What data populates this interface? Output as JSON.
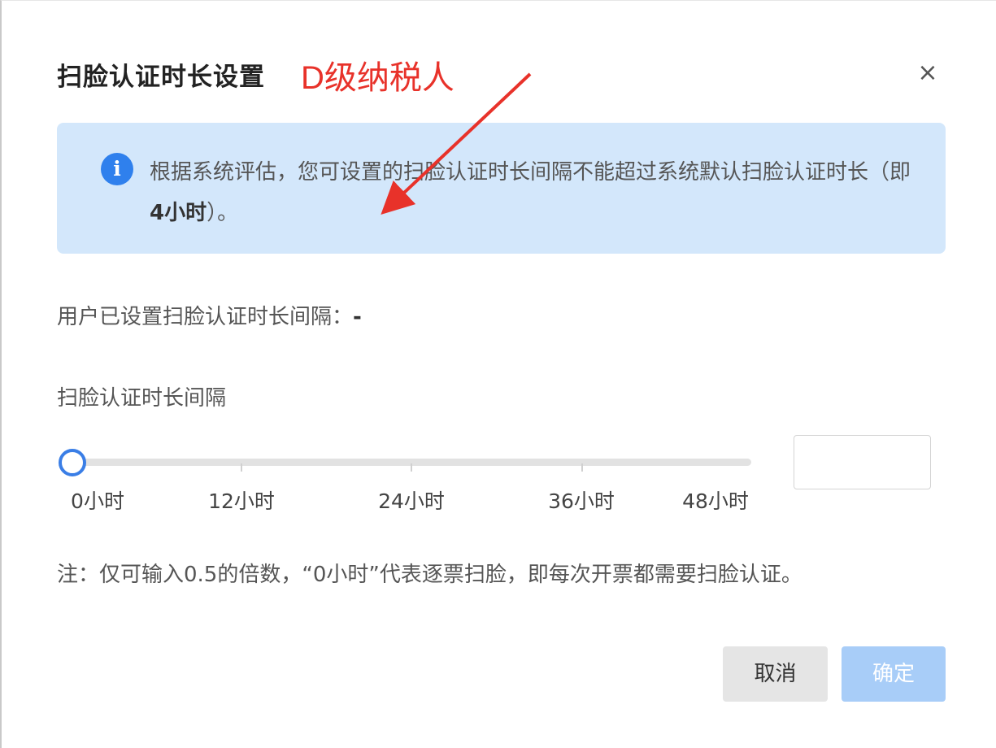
{
  "dialog": {
    "title": "扫脸认证时长设置",
    "annotation": "D级纳税人",
    "close_label": "×"
  },
  "info": {
    "icon": "info-icon",
    "icon_glyph": "i",
    "text_prefix": "根据系统评估，您可设置的扫脸认证时长间隔不能超过系统默认扫脸认证时长（即",
    "text_bold": "4小时",
    "text_suffix": "）。"
  },
  "user_setting": {
    "label": "用户已设置扫脸认证时长间隔：",
    "value": "-"
  },
  "slider": {
    "label": "扫脸认证时长间隔",
    "value_hours": 0,
    "min_hours": 0,
    "max_hours": 48,
    "ticks": [
      "0小时",
      "12小时",
      "24小时",
      "36小时",
      "48小时"
    ],
    "input_value": ""
  },
  "note": "注：仅可输入0.5的倍数，“0小时”代表逐票扫脸，即每次开票都需要扫脸认证。",
  "buttons": {
    "cancel": "取消",
    "confirm": "确定"
  },
  "colors": {
    "accent": "#3a7ee6",
    "info_bg": "#d3e7fb",
    "annotation_red": "#e8322a",
    "confirm_disabled": "#a8cdf8"
  }
}
